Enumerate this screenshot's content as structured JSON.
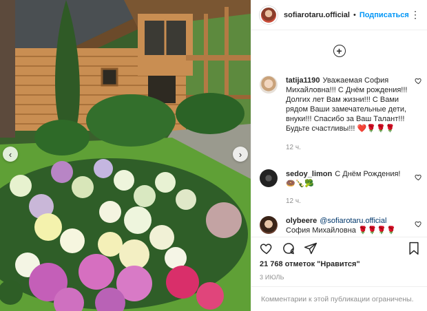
{
  "post": {
    "author": "sofiarotaru.official",
    "separator": "•",
    "follow_label": "Подписаться",
    "more_label": "⋮"
  },
  "carousel": {
    "prev_label": "‹",
    "next_label": "›"
  },
  "add_label": "+",
  "comments": [
    {
      "user": "tatija1190",
      "text": "Уважаемая София Михайловна!!! С Днём рождения!!! Долгих лет Вам жизни!!! С Вами рядом Ваши замечательные дети, внуки!!! Спасибо за Ваш Талант!!! Будьте счастливы!!! ❤️🌹🌹🌹",
      "time": "12 ч."
    },
    {
      "user": "sedoy_limon",
      "text": "С Днём Рождения! 🍩🍾🥦",
      "time": "12 ч."
    },
    {
      "user": "olybeere",
      "mention": "@sofiarotaru.official",
      "text": "София Михайловна 🌹🌹🌹🌹"
    }
  ],
  "likes": "21 768 отметок \"Нравится\"",
  "date": "3 ИЮЛЬ",
  "comments_restricted": "Комментарии к этой публикации ограничены.",
  "colors": {
    "accent": "#0095f6",
    "text": "#262626",
    "muted": "#8e8e8e",
    "border": "#efefef"
  },
  "icons": [
    "heart-icon",
    "comment-icon",
    "share-icon",
    "bookmark-icon",
    "more-icon",
    "add-circle-icon",
    "chevron-left-icon",
    "chevron-right-icon"
  ]
}
